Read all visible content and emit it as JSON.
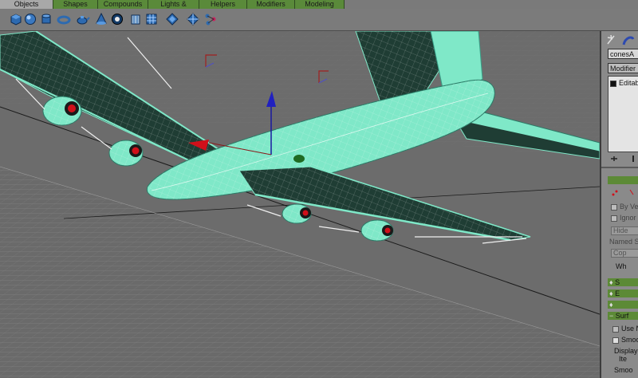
{
  "tabs": [
    {
      "label": "Objects",
      "active": true
    },
    {
      "label": "Shapes",
      "active": false
    },
    {
      "label": "Compounds",
      "active": false
    },
    {
      "label": "Lights & Cameras",
      "active": false
    },
    {
      "label": "Helpers",
      "active": false
    },
    {
      "label": "Modifiers",
      "active": false
    },
    {
      "label": "Modeling",
      "active": false
    }
  ],
  "toolbar_icons": [
    "box-icon",
    "sphere-icon",
    "cylinder-icon",
    "torus-icon",
    "teapot-icon",
    "cone-icon",
    "geosphere-icon",
    "tube-icon",
    "plane-icon",
    "scatter-icon",
    "connect-icon",
    "bone-icon"
  ],
  "panel": {
    "object_name": "conesA",
    "modifier_list": "Modifier Lis",
    "stack_item": "Editabl",
    "rollouts": {
      "selection_label": "",
      "soft_selection": "S",
      "edit_geometry": "E",
      "surface": "Surf"
    },
    "options": {
      "by_vertex": "By Ver",
      "ignore": "Ignor",
      "hide": "Hide",
      "named_sel": "Named Se",
      "copy": "Cop",
      "whole": "Wh",
      "use_nurms": "Use N",
      "smooth": "Smoo",
      "display": "Display",
      "iterations": "Ite",
      "smoothness": "Smoo"
    }
  },
  "colors": {
    "mesh_cyan": "#7fe8c8",
    "mesh_dark": "#1e3a32",
    "engine_red": "#d0101a",
    "tab_green": "#5a8a3a",
    "rollout_green": "#5c8a36"
  }
}
